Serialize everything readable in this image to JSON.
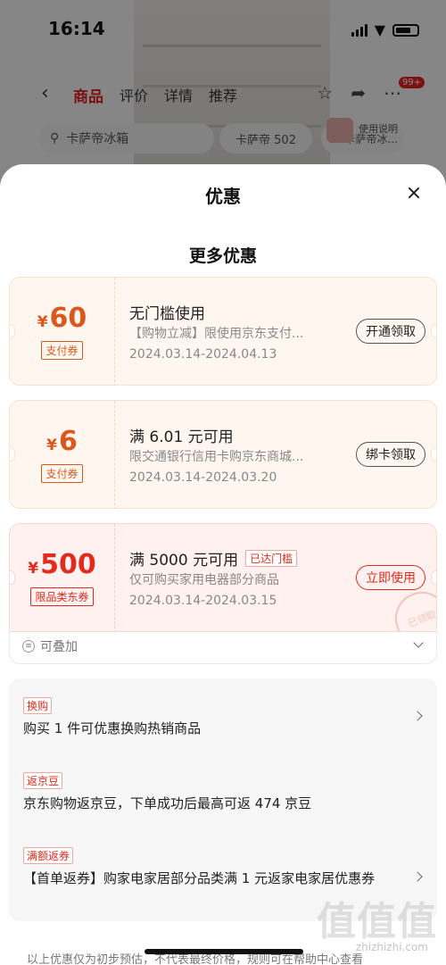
{
  "status": {
    "time": "16:14"
  },
  "background": {
    "tabs": [
      "商品",
      "评价",
      "详情",
      "推荐"
    ],
    "badge": "99+",
    "search_text": "卡萨帝冰箱",
    "chip1": "卡萨帝 502",
    "chip2": "卡萨帝冰...",
    "help_label": "使用说明"
  },
  "sheet": {
    "title": "优惠",
    "section_title": "更多优惠"
  },
  "coupons": [
    {
      "currency": "¥",
      "amount": "60",
      "type": "支付券",
      "title": "无门槛使用",
      "tag": "",
      "desc": "【购物立减】限使用京东支付...",
      "date": "2024.03.14-2024.04.13",
      "button": "开通领取"
    },
    {
      "currency": "¥",
      "amount": "6",
      "type": "支付券",
      "title": "满 6.01 元可用",
      "tag": "",
      "desc": "限交通银行信用卡购京东商城...",
      "date": "2024.03.14-2024.03.20",
      "button": "绑卡领取"
    },
    {
      "currency": "¥",
      "amount": "500",
      "type": "限品类东券",
      "title": "满 5000 元可用",
      "tag": "已达门槛",
      "desc": "仅可购买家用电器部分商品",
      "date": "2024.03.14-2024.03.15",
      "button": "立即使用",
      "stamp": "已领取"
    }
  ],
  "stackable": "可叠加",
  "promos": [
    {
      "tag": "换购",
      "text": "购买 1 件可优惠换购热销商品"
    },
    {
      "tag": "返京豆",
      "text": "京东购物返京豆，下单成功后最高可返 474 京豆"
    },
    {
      "tag": "满额返券",
      "text": "【首单返券】购家电家居部分品类满 1 元返家电家居优惠券"
    }
  ],
  "footer": "以上优惠仅为初步预估，不代表最终价格，规则可在帮助中心查看",
  "watermark": "值值值",
  "watermark_sub": "zhizhizhi.com",
  "colors": {
    "accent": "#e02b1e",
    "orange": "#d8581e"
  }
}
